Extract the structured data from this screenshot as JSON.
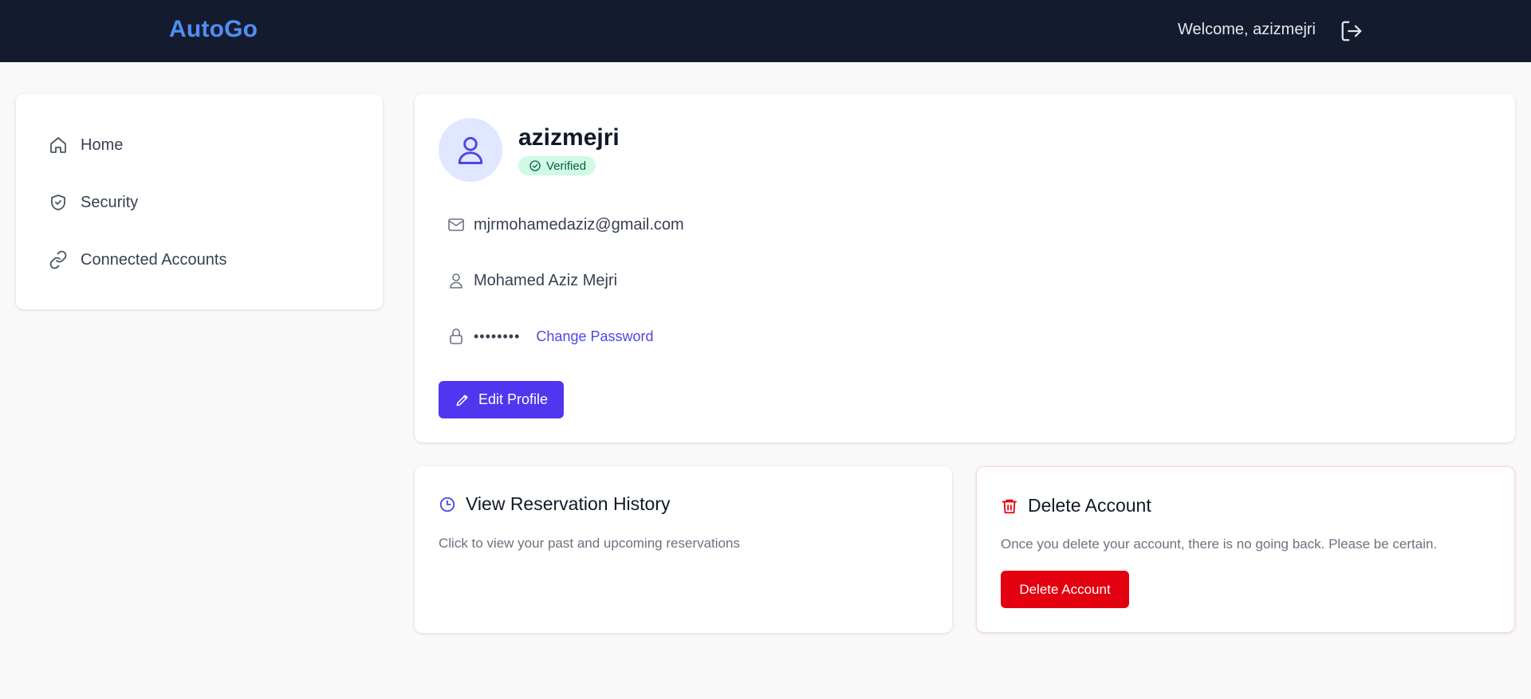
{
  "header": {
    "brand": "AutoGo",
    "welcome": "Welcome, azizmejri",
    "logout_icon": "logout-icon"
  },
  "sidebar": {
    "items": [
      {
        "label": "Home",
        "icon": "home-icon"
      },
      {
        "label": "Security",
        "icon": "shield-icon"
      },
      {
        "label": "Connected Accounts",
        "icon": "link-icon"
      }
    ]
  },
  "profile": {
    "username": "azizmejri",
    "badge": "Verified",
    "email": "mjrmohamedaziz@gmail.com",
    "full_name": "Mohamed Aziz Mejri",
    "password_mask": "••••••••",
    "change_password": "Change Password",
    "edit_button": "Edit Profile"
  },
  "reservations": {
    "title": "View Reservation History",
    "description": "Click to view your past and upcoming reservations"
  },
  "delete_account": {
    "title": "Delete Account",
    "description": "Once you delete your account, there is no going back. Please be certain.",
    "button": "Delete Account"
  },
  "colors": {
    "header_bg": "#151b2f",
    "brand": "#4f8ef5",
    "primary": "#5036ef",
    "danger": "#e3000f",
    "verified_bg": "#d1fae5"
  }
}
